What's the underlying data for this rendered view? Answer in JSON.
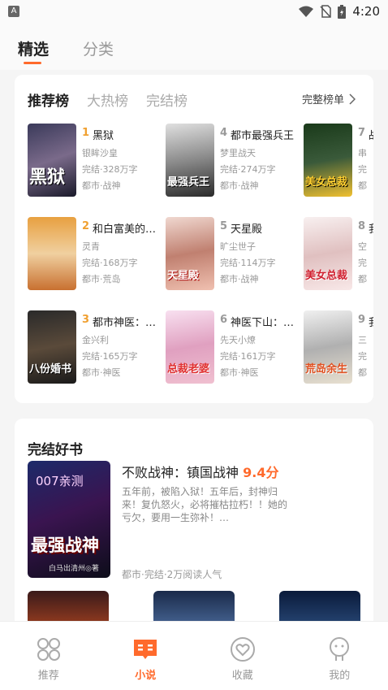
{
  "status": {
    "app_icon": "A",
    "time": "4:20",
    "icons": [
      "wifi-icon",
      "no-sim-icon",
      "battery-icon"
    ]
  },
  "top_tabs": [
    {
      "label": "精选",
      "active": true
    },
    {
      "label": "分类",
      "active": false
    }
  ],
  "ranking": {
    "tabs": [
      {
        "label": "推荐榜",
        "active": true
      },
      {
        "label": "大热榜",
        "active": false
      },
      {
        "label": "完结榜",
        "active": false
      }
    ],
    "more_label": "完整榜单",
    "books": [
      {
        "rank": "1",
        "title": "黑狱",
        "author": "银眸沙皇",
        "status": "完结·328万字",
        "tags": "都市·战神",
        "cover_text": "黑狱"
      },
      {
        "rank": "2",
        "title": "和白富美的…",
        "author": "灵青",
        "status": "完结·168万字",
        "tags": "都市·荒岛",
        "cover_text": ""
      },
      {
        "rank": "3",
        "title": "都市神医：…",
        "author": "金兴利",
        "status": "完结·165万字",
        "tags": "都市·神医",
        "cover_text": "八份婚书"
      },
      {
        "rank": "4",
        "title": "都市最强兵王",
        "author": "梦里战天",
        "status": "完结·274万字",
        "tags": "都市·战神",
        "cover_text": "最强兵王"
      },
      {
        "rank": "5",
        "title": "天星殿",
        "author": "旷尘世子",
        "status": "完结·114万字",
        "tags": "都市·战神",
        "cover_text": "天星殿"
      },
      {
        "rank": "6",
        "title": "神医下山：…",
        "author": "先天小燎",
        "status": "完结·161万字",
        "tags": "都市·神医",
        "cover_text": "总裁老婆"
      },
      {
        "rank": "7",
        "title": "战",
        "author": "串",
        "status": "完",
        "tags": "都",
        "cover_text": "美女总裁"
      },
      {
        "rank": "8",
        "title": "我",
        "author": "空",
        "status": "完",
        "tags": "都",
        "cover_text": "美女总裁"
      },
      {
        "rank": "9",
        "title": "我",
        "author": "三",
        "status": "完",
        "tags": "都",
        "cover_text": "荒岛余生"
      }
    ]
  },
  "completed": {
    "section_title": "完结好书",
    "featured": {
      "title": "不败战神：镇国战神",
      "score": "9.4分",
      "description": "五年前，被陷入狱！五年后，封神归来！复仇怒火，必将摧枯拉朽！！她的亏欠，要用一生弥补！…",
      "meta": "都市·完结·2万阅读人气",
      "cover_top": "007亲测",
      "cover_main": "最强战神",
      "cover_author": "白马出清州◎著"
    }
  },
  "bottom_nav": [
    {
      "label": "推荐",
      "icon": "grid-icon",
      "active": false
    },
    {
      "label": "小说",
      "icon": "book-icon",
      "active": true
    },
    {
      "label": "收藏",
      "icon": "heart-icon",
      "active": false
    },
    {
      "label": "我的",
      "icon": "profile-icon",
      "active": false
    }
  ],
  "colors": {
    "accent": "#ff6a2c",
    "rank_top": "#f0a030",
    "rank_other": "#999999"
  }
}
